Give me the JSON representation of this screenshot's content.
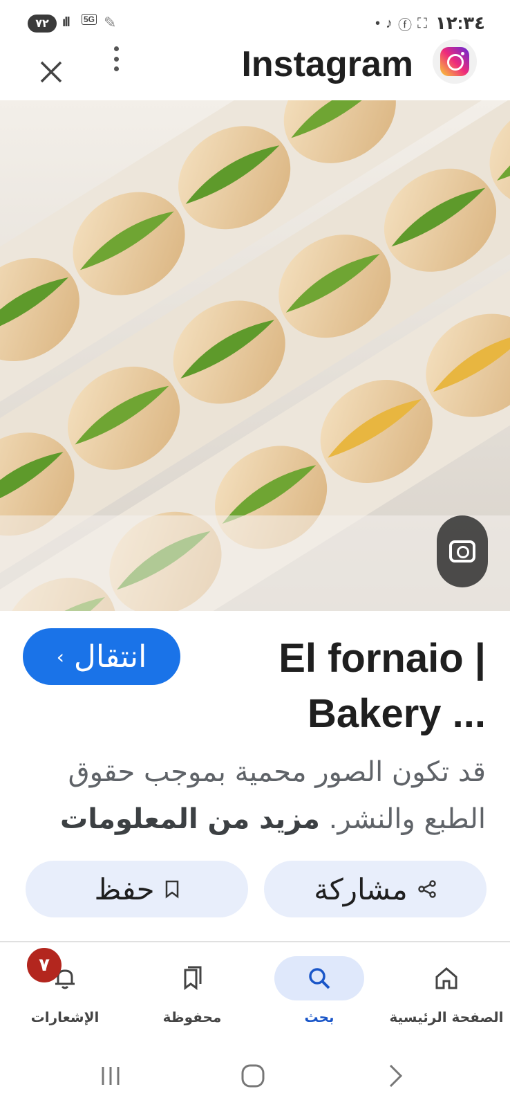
{
  "status_bar": {
    "battery": "٧٢",
    "network": "5G",
    "time": "١٢:٣٤"
  },
  "header": {
    "site_title": "Instagram"
  },
  "result": {
    "title": "El fornaio | Bakery ...",
    "visit_label": "انتقال",
    "copyright_text": "قد تكون الصور محمية بموجب حقوق الطبع والنشر.",
    "more_info_label": "مزيد من المعلومات",
    "share_label": "مشاركة",
    "save_label": "حفظ"
  },
  "bottom_nav": {
    "items": [
      {
        "label": "الصفحة الرئيسية",
        "icon": "home-icon"
      },
      {
        "label": "بحث",
        "icon": "search-icon",
        "active": true
      },
      {
        "label": "محفوظة",
        "icon": "bookmarks-icon"
      },
      {
        "label": "الإشعارات",
        "icon": "bell-icon",
        "badge": "٧"
      }
    ]
  },
  "colors": {
    "accent": "#1a73e8",
    "badge": "#b3261e",
    "pill_bg": "#e8eefb"
  }
}
